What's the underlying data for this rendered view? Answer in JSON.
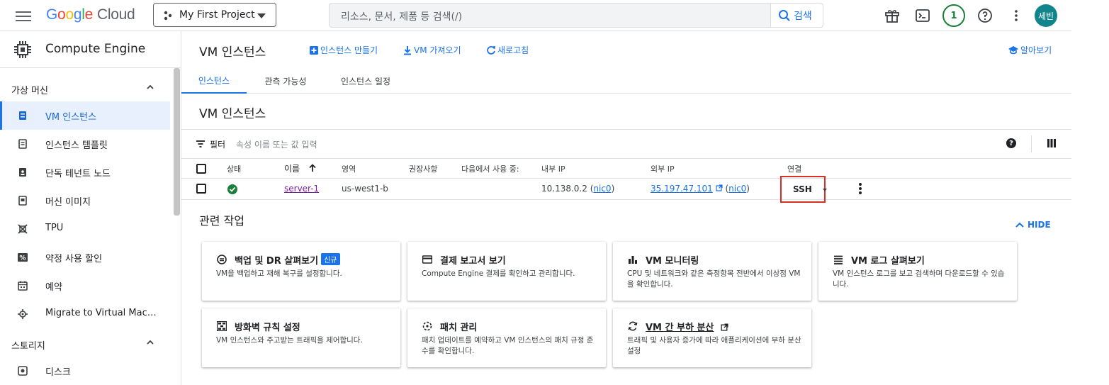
{
  "topbar": {
    "logo_google": [
      "G",
      "o",
      "o",
      "g",
      "l",
      "e"
    ],
    "logo_cloud": "Cloud",
    "project": "My First Project",
    "search_placeholder": "리소스, 문서, 제품 등 검색(/)",
    "search_button": "검색",
    "notifications_count": "1",
    "avatar_initials": "세빈"
  },
  "sidebar": {
    "product_title": "Compute Engine",
    "sections": [
      {
        "label": "가상 머신"
      },
      {
        "label": "스토리지"
      }
    ],
    "items": [
      {
        "label": "VM 인스턴스",
        "icon": "vm-instance-icon"
      },
      {
        "label": "인스턴스 템플릿",
        "icon": "template-icon"
      },
      {
        "label": "단독 테넌트 노드",
        "icon": "sole-tenant-icon"
      },
      {
        "label": "머신 이미지",
        "icon": "machine-image-icon"
      },
      {
        "label": "TPU",
        "icon": "tpu-icon"
      },
      {
        "label": "약정 사용 할인",
        "icon": "discount-icon"
      },
      {
        "label": "예약",
        "icon": "reservation-icon"
      },
      {
        "label": "Migrate to Virtual Machin...",
        "icon": "migrate-icon"
      },
      {
        "label": "디스크",
        "icon": "disk-icon"
      }
    ]
  },
  "header": {
    "title": "VM 인스턴스",
    "create_label": "인스턴스 만들기",
    "import_label": "VM 가져오기",
    "refresh_label": "새로고침",
    "learn_label": "알아보기"
  },
  "tabs": [
    {
      "label": "인스턴스",
      "active": true
    },
    {
      "label": "관측 가능성",
      "active": false
    },
    {
      "label": "인스턴스 일정",
      "active": false
    }
  ],
  "subtitle": "VM 인스턴스",
  "filter": {
    "label": "필터",
    "placeholder": "속성 이름 또는 값 입력",
    "help": "?"
  },
  "table": {
    "columns": [
      "상태",
      "이름",
      "영역",
      "권장사항",
      "다음에서 사용 중:",
      "내부 IP",
      "외부 IP",
      "연결"
    ],
    "rows": [
      {
        "status": "running",
        "name": "server-1",
        "zone": "us-west1-b",
        "recommendation": "",
        "in_use_by": "",
        "internal_ip": "10.138.0.2",
        "internal_nic": "nic0",
        "external_ip": "35.197.47.101",
        "external_nic": "nic0",
        "connect": "SSH"
      }
    ]
  },
  "related": {
    "title": "관련 작업",
    "hide_label": "HIDE",
    "cards": [
      {
        "title": "백업 및 DR 살펴보기",
        "tag": "신규",
        "desc": "VM을 백업하고 재해 복구를 설정합니다.",
        "icon": "backup-icon"
      },
      {
        "title": "결제 보고서 보기",
        "desc": "Compute Engine 결제를 확인하고 관리합니다.",
        "icon": "billing-icon"
      },
      {
        "title": "VM 모니터링",
        "desc": "CPU 및 네트워크와 같은 측정항목 전반에서 이상점 VM을 확인합니다.",
        "icon": "monitoring-icon"
      },
      {
        "title": "VM 로그 살펴보기",
        "desc": "VM 인스턴스 로그를 보고 검색하며 다운로드할 수 있습니다.",
        "icon": "logs-icon"
      },
      {
        "title": "방화벽 규칙 설정",
        "desc": "VM 인스턴스와 주고받는 트래픽을 제어합니다.",
        "icon": "firewall-icon"
      },
      {
        "title": "패치 관리",
        "desc": "패치 업데이트를 예약하고 VM 인스턴스의 패치 규정 준수를 확인합니다.",
        "icon": "patch-icon"
      },
      {
        "title": "VM 간 부하 분산",
        "desc": "트래픽 및 사용자 증가에 따라 애플리케이션에 부하 분산 설정",
        "icon": "load-balancing-icon"
      }
    ]
  },
  "colors": {
    "accent": "#1a73e8",
    "status_ok": "#188038",
    "highlight": "#d93025"
  }
}
